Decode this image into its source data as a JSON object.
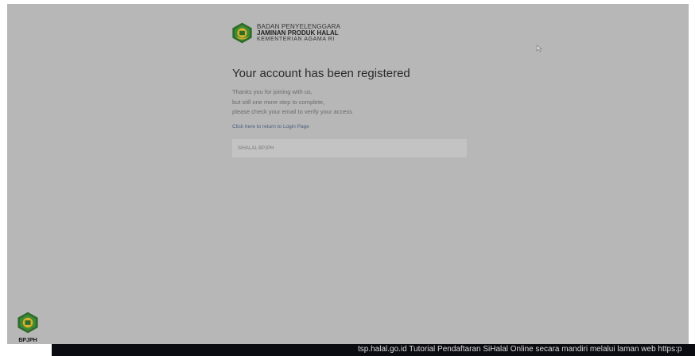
{
  "brand": {
    "line1": "BADAN PENYELENGGARA",
    "line2": "JAMINAN PRODUK HALAL",
    "line3": "KEMENTERIAN AGAMA RI",
    "emblem_icon": "kemenag-emblem-icon",
    "colors": {
      "emblem_green": "#2e6b2a",
      "emblem_gold": "#d8b02c"
    }
  },
  "registration": {
    "title": "Your account has been registered",
    "message_lines": [
      "Thanks you for joining with us,",
      "but still one more step to complete,",
      "please check your email to verify your access"
    ],
    "login_link": "Click here to return to Login Page",
    "footer_label": "SIHALAL BPJPH"
  },
  "watermark": {
    "label": "BPJPH",
    "icon": "bpjph-emblem-icon"
  },
  "ticker": {
    "text": "tsp.halal.go.id  Tutorial Pendaftaran SiHalal Online secara mandiri melalui laman web https:p"
  },
  "theme": {
    "page_bg": "#b7b7b7",
    "ticker_bg": "#0b0b12",
    "link_color": "#4c5f80"
  }
}
